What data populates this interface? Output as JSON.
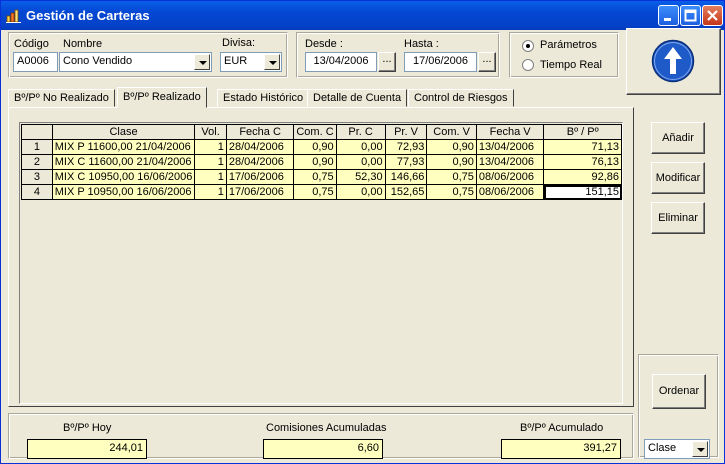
{
  "window": {
    "title": "Gestión de Carteras"
  },
  "header": {
    "codigo_label": "Código",
    "nombre_label": "Nombre",
    "codigo_value": "A0006",
    "nombre_value": "Cono Vendido",
    "divisa_label": "Divisa:",
    "divisa_value": "EUR",
    "desde_label": "Desde :",
    "desde_value": "13/04/2006",
    "hasta_label": "Hasta :",
    "hasta_value": "17/06/2006",
    "dots_label": "...",
    "mode_options": [
      {
        "label": "Parámetros",
        "selected": true
      },
      {
        "label": "Tiempo Real",
        "selected": false
      }
    ]
  },
  "tabs": [
    {
      "label": "Bº/Pº No Realizado",
      "active": false
    },
    {
      "label": "Bº/Pº Realizado",
      "active": true
    },
    {
      "label": "Estado Histórico",
      "active": false
    },
    {
      "label": "Detalle de Cuenta",
      "active": false
    },
    {
      "label": "Control de Riesgos",
      "active": false
    }
  ],
  "table": {
    "columns": [
      "Clase",
      "Vol.",
      "Fecha C",
      "Com. C",
      "Pr. C",
      "Pr. V",
      "Com. V",
      "Fecha V",
      "Bº / Pº"
    ],
    "rows": [
      {
        "n": "1",
        "cells": [
          "MIX P 11600,00 21/04/2006",
          "1",
          "28/04/2006",
          "0,90",
          "0,00",
          "72,93",
          "0,90",
          "13/04/2006",
          "71,13"
        ]
      },
      {
        "n": "2",
        "cells": [
          "MIX C 11600,00 21/04/2006",
          "1",
          "28/04/2006",
          "0,90",
          "0,00",
          "77,93",
          "0,90",
          "13/04/2006",
          "76,13"
        ]
      },
      {
        "n": "3",
        "cells": [
          "MIX C 10950,00 16/06/2006",
          "1",
          "17/06/2006",
          "0,75",
          "52,30",
          "146,66",
          "0,75",
          "08/06/2006",
          "92,86"
        ]
      },
      {
        "n": "4",
        "cells": [
          "MIX P 10950,00 16/06/2006",
          "1",
          "17/06/2006",
          "0,75",
          "0,00",
          "152,65",
          "0,75",
          "08/06/2006",
          "151,15"
        ]
      }
    ]
  },
  "actions": {
    "add": "Añadir",
    "modify": "Modificar",
    "delete": "Eliminar",
    "sort": "Ordenar",
    "sort_field": "Clase"
  },
  "totals": {
    "hoy_label": "Bº/Pº Hoy",
    "hoy_value": "244,01",
    "comisiones_label": "Comisiones Acumuladas",
    "comisiones_value": "6,60",
    "acumulado_label": "Bº/Pº Acumulado",
    "acumulado_value": "391,27"
  },
  "colors": {
    "titlebar": "#0447d2",
    "cell_bg": "#ffffc0",
    "big_button": "#1f5bc8"
  }
}
